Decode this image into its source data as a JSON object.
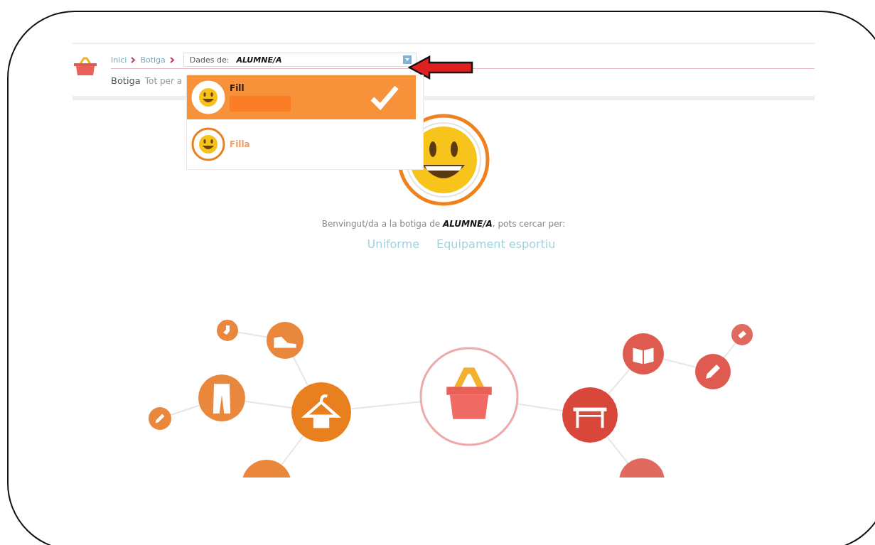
{
  "breadcrumb": [
    {
      "label": "Inici"
    },
    {
      "label": "Botiga"
    }
  ],
  "data_selector": {
    "label": "Dades de:",
    "value": "ALUMNE/A"
  },
  "page_header": {
    "title": "Botiga",
    "subtitle": "Tot per a"
  },
  "dropdown": {
    "items": [
      {
        "name": "Fill",
        "selected": true,
        "redacted": true
      },
      {
        "name": "Filla",
        "selected": false,
        "redacted": false
      }
    ]
  },
  "welcome": "Benvingut/da a la botiga de **ALUMNE/A**, pots cercar per:",
  "links": [
    {
      "label": "Uniforme"
    },
    {
      "label": "Equipament esportiu"
    }
  ]
}
